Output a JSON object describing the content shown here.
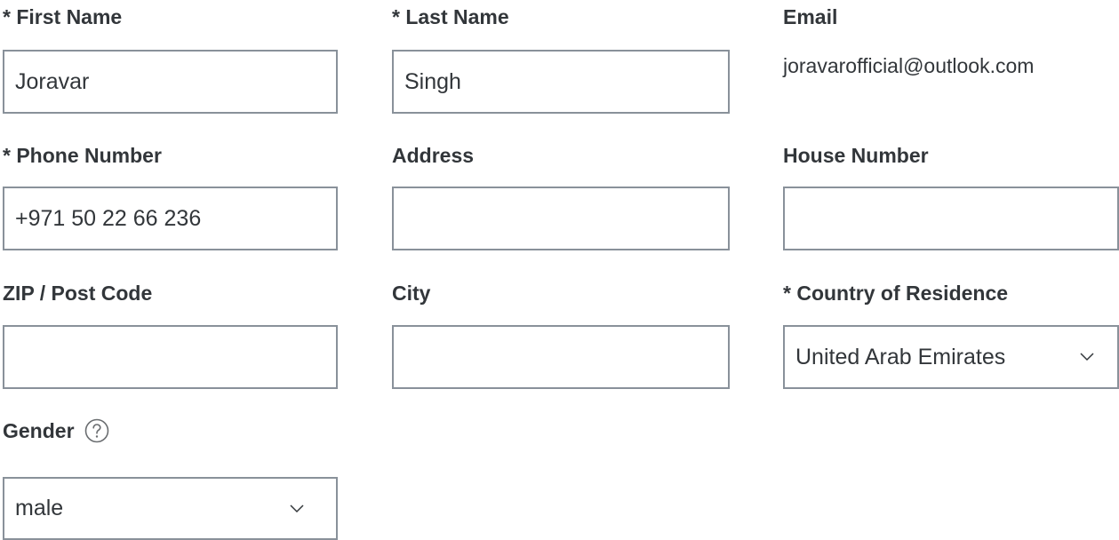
{
  "form": {
    "first_name": {
      "label": "* First Name",
      "value": "Joravar"
    },
    "last_name": {
      "label": "* Last Name",
      "value": "Singh"
    },
    "email": {
      "label": "Email",
      "value": "joravarofficial@outlook.com"
    },
    "phone": {
      "label": "* Phone Number",
      "value": "+971 50 22 66 236"
    },
    "address": {
      "label": "Address",
      "value": ""
    },
    "house_number": {
      "label": "House Number",
      "value": ""
    },
    "zip": {
      "label": "ZIP / Post Code",
      "value": ""
    },
    "city": {
      "label": "City",
      "value": ""
    },
    "country": {
      "label": "* Country of Residence",
      "selected": "United Arab Emirates"
    },
    "gender": {
      "label": "Gender",
      "selected": "male"
    }
  },
  "icons": {
    "dropdown": "chevron-down-icon",
    "help": "question-circle-icon"
  },
  "colors": {
    "border": "#89919a",
    "text": "#32363a",
    "background": "#ffffff"
  }
}
